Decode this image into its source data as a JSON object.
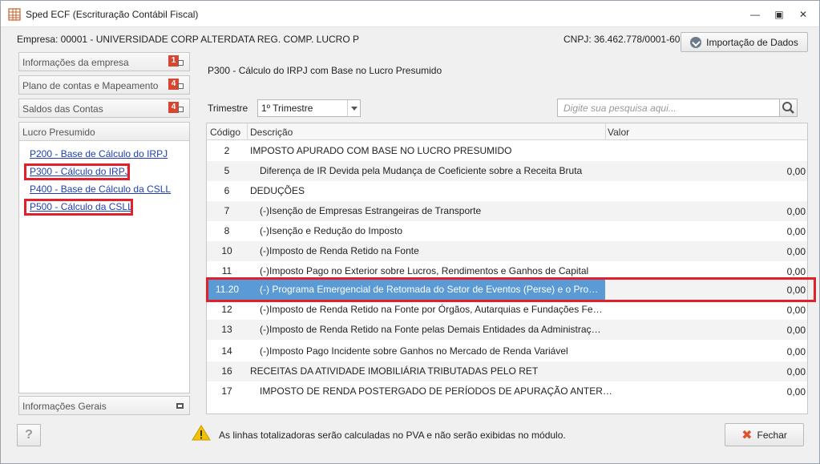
{
  "window": {
    "title": "Sped ECF (Escrituração Contábil Fiscal)"
  },
  "header": {
    "empresa": "Empresa: 00001 - UNIVERSIDADE CORP ALTERDATA REG. COMP. LUCRO P",
    "cnpj": "CNPJ: 36.462.778/0001-60",
    "import_button": "Importação de Dados"
  },
  "sidebar": {
    "items": [
      {
        "label": "Informações da empresa",
        "badge": "1"
      },
      {
        "label": "Plano de contas e Mapeamento",
        "badge": "4"
      },
      {
        "label": "Saldos das Contas",
        "badge": "4"
      }
    ],
    "group": {
      "title": "Lucro Presumido",
      "links": [
        "P200 - Base de Cálculo do IRPJ",
        "P300 - Cálculo do IRPJ",
        "P400 - Base de Cálculo da CSLL",
        "P500 - Cálculo da CSLL"
      ]
    },
    "footer_item": "Informações Gerais"
  },
  "main": {
    "section_title": "P300 - Cálculo do IRPJ com Base no Lucro Presumido",
    "trimestre_label": "Trimestre",
    "trimestre_value": "1º Trimestre",
    "search_placeholder": "Digite sua pesquisa aqui...",
    "columns": [
      "Código",
      "Descrição",
      "Valor"
    ],
    "rows": [
      {
        "cod": "2",
        "desc": "IMPOSTO APURADO COM BASE NO LUCRO PRESUMIDO",
        "val": ""
      },
      {
        "cod": "5",
        "desc": "Diferença de IR Devida pela Mudança de Coeficiente sobre a Receita Bruta",
        "val": "0,00"
      },
      {
        "cod": "6",
        "desc": "DEDUÇÕES",
        "val": ""
      },
      {
        "cod": "7",
        "desc": "(-)Isenção de Empresas Estrangeiras de Transporte",
        "val": "0,00"
      },
      {
        "cod": "8",
        "desc": "(-)Isenção e Redução do Imposto",
        "val": "0,00"
      },
      {
        "cod": "10",
        "desc": "(-)Imposto de Renda Retido na Fonte",
        "val": "0,00"
      },
      {
        "cod": "11",
        "desc": "(-)Imposto Pago no Exterior sobre Lucros, Rendimentos e Ganhos de Capital",
        "val": "0,00"
      },
      {
        "cod": "11.20",
        "desc": "(-) Programa Emergencial de Retomada do Setor de Eventos (Perse) e o Progra...",
        "val": "0,00"
      },
      {
        "cod": "12",
        "desc": "(-)Imposto de Renda Retido na Fonte por Órgãos, Autarquias e Fundações Feder...",
        "val": "0,00"
      },
      {
        "cod": "13",
        "desc": "(-)Imposto de Renda Retido na Fonte pelas Demais Entidades da Administração ...",
        "val": "0,00"
      },
      {
        "cod": "14",
        "desc": "(-)Imposto Pago Incidente sobre Ganhos no Mercado de Renda Variável",
        "val": "0,00"
      },
      {
        "cod": "16",
        "desc": "RECEITAS DA ATIVIDADE IMOBILIÁRIA TRIBUTADAS PELO RET",
        "val": "0,00"
      },
      {
        "cod": "17",
        "desc": "IMPOSTO DE RENDA POSTERGADO DE PERÍODOS DE APURAÇÃO ANTERIORES",
        "val": "0,00"
      }
    ]
  },
  "footer": {
    "help": "?",
    "warning": "As linhas totalizadoras serão calculadas no PVA e não serão exibidas no módulo.",
    "close_button": "Fechar"
  },
  "colors": {
    "highlight": "#e0202b",
    "selection": "#5b9bd5",
    "badge": "#d74631",
    "link": "#1f3fb0"
  }
}
